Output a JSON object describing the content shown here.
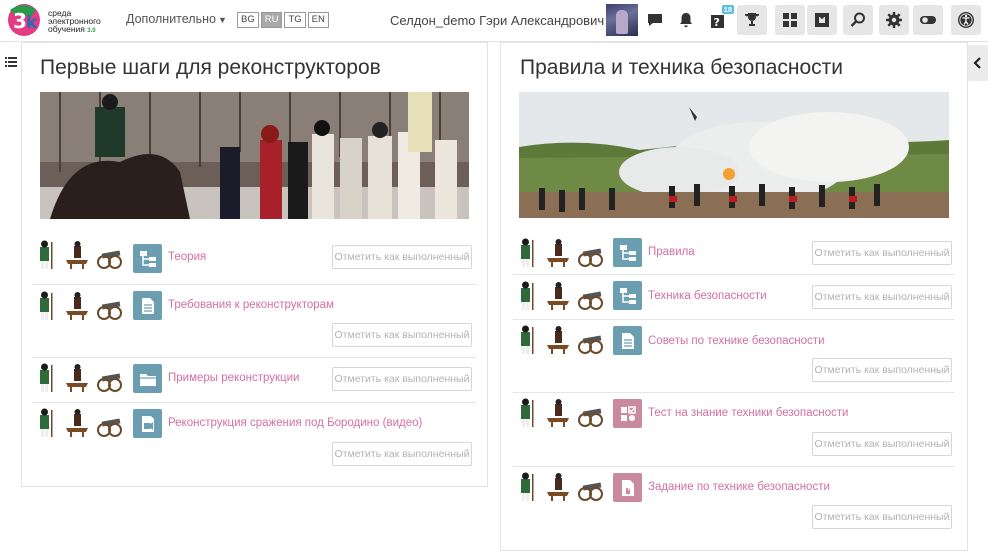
{
  "header": {
    "logo_line1": "среда",
    "logo_line2": "электронного",
    "logo_line3": "обучения",
    "logo_sub": "3.0",
    "more_label": "Дополнительно",
    "languages": [
      "BG",
      "RU",
      "TG",
      "EN"
    ],
    "active_language": "RU",
    "user_name": "Селдон_demo Гэри Александрович",
    "messages_badge": "18",
    "icons": [
      "chat-icon",
      "bell-icon",
      "help-icon",
      "trophy-icon",
      "grid-icon",
      "puzzle-icon",
      "search-icon",
      "gear-icon",
      "toggle-icon",
      "accessibility-icon"
    ]
  },
  "colors": {
    "link": "#d36fa2",
    "module_teal": "#6a9eb0",
    "module_pink": "#c98a9d"
  },
  "sections": [
    {
      "title": "Первые шаги для реконструкторов",
      "activities": [
        {
          "name": "Теория",
          "icon": "hierarchy-icon",
          "button": "Отметить как выполненный"
        },
        {
          "name": "Требования к реконструкторам",
          "icon": "document-icon",
          "button": "Отметить как выполненный"
        },
        {
          "name": "Примеры реконструкции",
          "icon": "folder-icon",
          "button": "Отметить как выполненный"
        },
        {
          "name": "Реконструкция сражения под Бородино (видео)",
          "icon": "video-page-icon",
          "button": "Отметить как выполненный"
        }
      ]
    },
    {
      "title": "Правила и техника безопасности",
      "activities": [
        {
          "name": "Правила",
          "icon": "hierarchy-icon",
          "button": "Отметить как выполненный"
        },
        {
          "name": "Техника безопасности",
          "icon": "hierarchy-icon",
          "button": "Отметить как выполненный"
        },
        {
          "name": "Советы по технике безопасности",
          "icon": "document-icon",
          "button": "Отметить как выполненный"
        },
        {
          "name": "Тест на знание техники безопасности",
          "icon": "quiz-icon",
          "button": "Отметить как выполненный"
        },
        {
          "name": "Задание по технике безопасности",
          "icon": "assignment-icon",
          "button": "Отметить как выполненный"
        }
      ]
    }
  ]
}
